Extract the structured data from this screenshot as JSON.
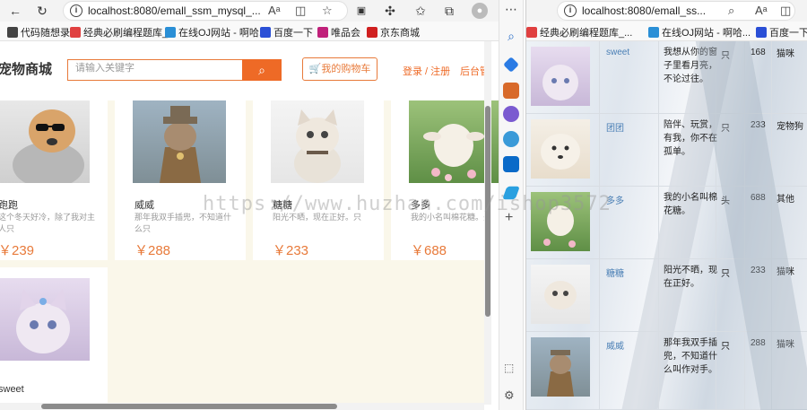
{
  "left_browser": {
    "url": "localhost:8080/emall_ssm_mysql_...",
    "bookmarks": [
      "代码随想录",
      "经典必刷编程题库_...",
      "在线OJ网站 - 啊哈...",
      "百度一下",
      "唯品会",
      "京东商城"
    ]
  },
  "right_browser": {
    "url": "localhost:8080/emall_ss...",
    "bookmarks": [
      "经典必刷编程题库_...",
      "在线OJ网站 - 啊哈...",
      "百度一下"
    ]
  },
  "shop": {
    "logo": "宠物商城",
    "search_placeholder": "请输入关键字",
    "cart_label": "🛒我的购物车",
    "login_label": "登录 / 注册",
    "admin_label": "后台管",
    "products": [
      {
        "name": "跑跑",
        "desc": "这个冬天好冷，除了我对主人只",
        "price": "￥239"
      },
      {
        "name": "威威",
        "desc": "那年我双手插兜，不知道什么只",
        "price": "￥288"
      },
      {
        "name": "糖糖",
        "desc": "阳光不晒，现在正好。只",
        "price": "￥233"
      },
      {
        "name": "多多",
        "desc": "我的小名叫棉花糖。头",
        "price": "￥688"
      },
      {
        "name": "sweet",
        "desc": "",
        "price": ""
      }
    ]
  },
  "table": {
    "rows": [
      {
        "name": "sweet",
        "desc": "我想从你的窗子里看月亮，不论过往。",
        "unit": "只",
        "stock": "168",
        "type": "猫咪"
      },
      {
        "name": "团团",
        "desc": "陪伴、玩赏，有我，你不在孤单。",
        "unit": "只",
        "stock": "233",
        "type": "宠物狗"
      },
      {
        "name": "多多",
        "desc": "我的小名叫棉花糖。",
        "unit": "头",
        "stock": "688",
        "type": "其他"
      },
      {
        "name": "糖糖",
        "desc": "阳光不晒，现在正好。",
        "unit": "只",
        "stock": "233",
        "type": "猫咪"
      },
      {
        "name": "威威",
        "desc": "那年我双手插兜，不知道什么叫作对手。",
        "unit": "只",
        "stock": "288",
        "type": "猫咪"
      }
    ]
  },
  "watermark": "https://www.huzhan.com/ishop3572",
  "colors": {
    "accent": "#ee6a26",
    "link": "#4a7fb5"
  }
}
